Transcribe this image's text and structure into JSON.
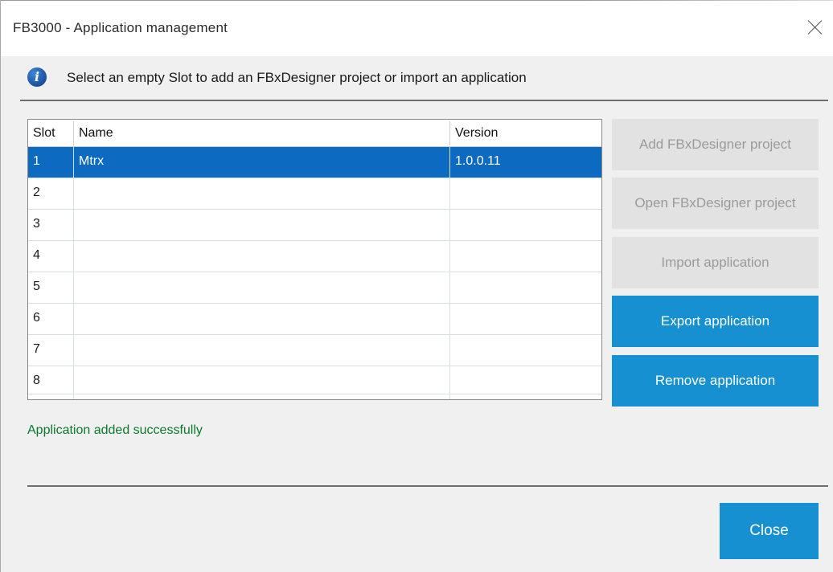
{
  "window": {
    "title": "FB3000 - Application management"
  },
  "info": {
    "icon": "info-icon",
    "message": "Select an empty Slot to add an FBxDesigner project or import an application"
  },
  "table": {
    "columns": [
      "Slot",
      "Name",
      "Version"
    ],
    "rows": [
      {
        "slot": "1",
        "name": "Mtrx",
        "version": "1.0.0.11",
        "selected": true
      },
      {
        "slot": "2",
        "name": "",
        "version": "",
        "selected": false
      },
      {
        "slot": "3",
        "name": "",
        "version": "",
        "selected": false
      },
      {
        "slot": "4",
        "name": "",
        "version": "",
        "selected": false
      },
      {
        "slot": "5",
        "name": "",
        "version": "",
        "selected": false
      },
      {
        "slot": "6",
        "name": "",
        "version": "",
        "selected": false
      },
      {
        "slot": "7",
        "name": "",
        "version": "",
        "selected": false
      },
      {
        "slot": "8",
        "name": "",
        "version": "",
        "selected": false
      }
    ]
  },
  "actions": {
    "add_project": "Add FBxDesigner project",
    "open_project": "Open FBxDesigner project",
    "import_app": "Import application",
    "export_app": "Export application",
    "remove_app": "Remove application"
  },
  "status": {
    "message": "Application added successfully",
    "color": "#0b7a2c"
  },
  "footer": {
    "close_label": "Close"
  },
  "colors": {
    "accent": "#1690d0",
    "selection": "#0c6bc1",
    "disabled_bg": "#e2e2e2",
    "disabled_text": "#9a9a9a"
  }
}
